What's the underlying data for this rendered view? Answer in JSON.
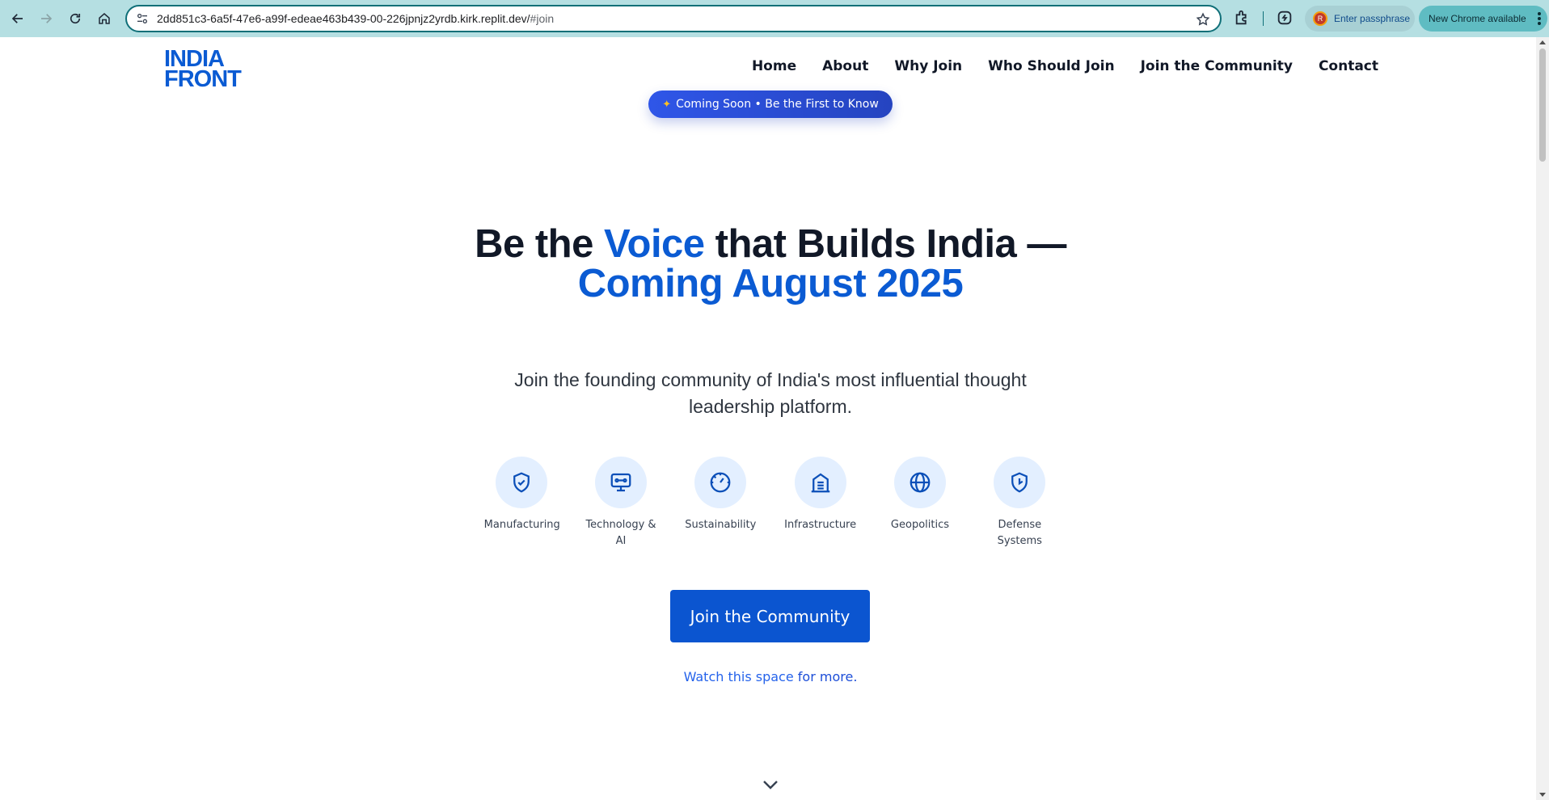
{
  "browser": {
    "url_main": "2dd851c3-6a5f-47e6-a99f-edeae463b439-00-226jpnjz2yrdb.kirk.replit.dev/",
    "url_hash": "#join",
    "passphrase_label": "Enter passphrase",
    "update_label": "New Chrome available",
    "avatar_letter": "R"
  },
  "site": {
    "logo_line1": "INDIA",
    "logo_line2": "FRONT",
    "brand_color": "#0b5bd3",
    "nav": [
      "Home",
      "About",
      "Why Join",
      "Who Should Join",
      "Join the Community",
      "Contact"
    ]
  },
  "hero": {
    "badge_icon": "sparkle-icon",
    "badge_text": "Coming Soon • Be the First to Know",
    "headline_part1": "Be the ",
    "headline_blue1": "Voice",
    "headline_part2": " that Builds India —",
    "headline_blue2": "Coming August 2025",
    "subtitle": "Join the founding community of India's most influential thought leadership platform.",
    "topics": [
      {
        "label": "Manufacturing",
        "icon": "shield-check-icon"
      },
      {
        "label": "Technology & AI",
        "icon": "monitor-icon"
      },
      {
        "label": "Sustainability",
        "icon": "gauge-icon"
      },
      {
        "label": "Infrastructure",
        "icon": "building-icon"
      },
      {
        "label": "Geopolitics",
        "icon": "globe-icon"
      },
      {
        "label": "Defense Systems",
        "icon": "shield-icon"
      }
    ],
    "cta_label": "Join the Community",
    "watch_part1": "Watch this space ",
    "watch_part2": "for more.",
    "scroll_icon": "chevron-down-icon"
  }
}
